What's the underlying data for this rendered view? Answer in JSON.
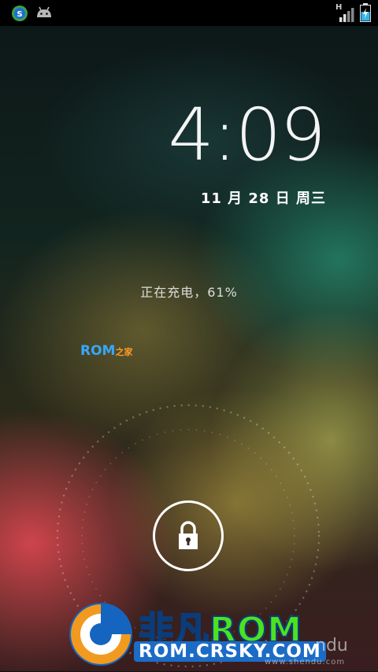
{
  "status_bar": {
    "notification_icons": [
      "shendu-update-icon",
      "android-icon"
    ],
    "network_type": "H",
    "system_icons": [
      "signal-bars-icon",
      "battery-charging-icon"
    ]
  },
  "lock_screen": {
    "time": "4:09",
    "date": "11 月 28 日 周三",
    "charging_status": "正在充电，61%",
    "battery_percent": 61,
    "unlock_icon": "lock-icon"
  },
  "watermarks": {
    "rom_home_main": "ROM",
    "rom_home_suffix": "之家",
    "brand_title": "非凡ROM",
    "brand_url": "ROM.CRSKY.COM",
    "shendu_logo": "ndu",
    "shendu_url": "www.shendu.com"
  },
  "colors": {
    "status_bar": "#000000",
    "rom_blue": "#36a8ff",
    "brand_green": "#4de21f",
    "brand_blue": "#1c6cc6"
  }
}
